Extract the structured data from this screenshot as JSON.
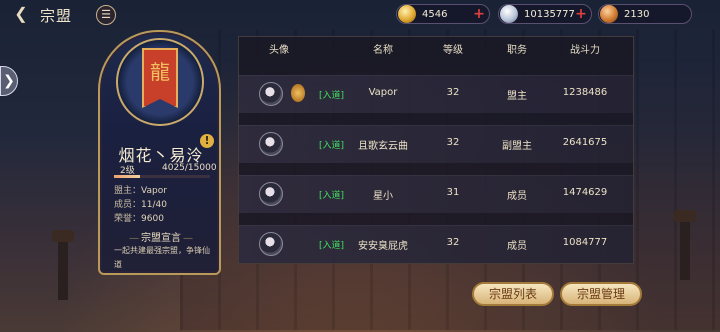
{
  "header": {
    "back_icon": "chevron-back-icon",
    "title": "宗盟",
    "menu_glyph": "☰"
  },
  "resources": [
    {
      "name": "gold",
      "value": "4546",
      "icon": "gold-ingot-icon",
      "has_plus": true
    },
    {
      "name": "silver",
      "value": "10135777",
      "icon": "silver-coin-icon",
      "has_plus": true
    },
    {
      "name": "copper",
      "value": "2130",
      "icon": "copper-coin-icon",
      "has_plus": false
    }
  ],
  "guild": {
    "name": "烟花丶易泠",
    "level": "2级",
    "exp": "4025/15000",
    "exp_fraction": 0.268,
    "leader_label": "盟主：",
    "leader": "Vapor",
    "members_label": "成员：",
    "members": "11/40",
    "honor_label": "荣誉：",
    "honor": "9600",
    "manifesto_title": "宗盟宣言",
    "manifesto": "一起共建最强宗盟，争锋仙道",
    "info_glyph": "!",
    "banner_glyph": "龍"
  },
  "table": {
    "headers": [
      "头像",
      "名称",
      "等级",
      "职务",
      "战斗力"
    ],
    "rows": [
      {
        "online": "[入道]",
        "name": "Vapor",
        "level": "32",
        "role": "盟主",
        "power": "1238486",
        "medal": true
      },
      {
        "online": "[入道]",
        "name": "且歌玄云曲",
        "level": "32",
        "role": "副盟主",
        "power": "2641675",
        "medal": false
      },
      {
        "online": "[入道]",
        "name": "星小",
        "level": "31",
        "role": "成员",
        "power": "1474629",
        "medal": false
      },
      {
        "online": "[入道]",
        "name": "安安臭屁虎",
        "level": "32",
        "role": "成员",
        "power": "1084777",
        "medal": false
      }
    ]
  },
  "buttons": {
    "list": "宗盟列表",
    "manage": "宗盟管理"
  },
  "colors": {
    "accent": "#c9aa6a",
    "online": "#40e060",
    "plus": "#e04040",
    "banner": "#c8402a"
  }
}
